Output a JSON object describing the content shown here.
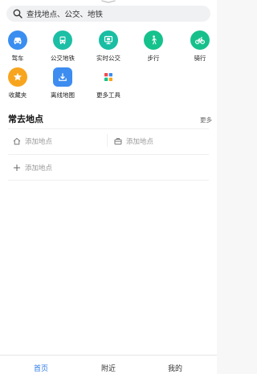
{
  "search": {
    "placeholder": "查找地点、公交、地铁",
    "icon": "search-icon"
  },
  "tools": [
    {
      "label": "驾车",
      "icon": "car-icon",
      "color": "#3a8ef0"
    },
    {
      "label": "公交地铁",
      "icon": "bus-icon",
      "color": "#1bbfa5"
    },
    {
      "label": "实时公交",
      "icon": "realtime-bus-icon",
      "color": "#19bea3"
    },
    {
      "label": "步行",
      "icon": "walk-icon",
      "color": "#16c28c"
    },
    {
      "label": "骑行",
      "icon": "bike-icon",
      "color": "#17c08b"
    },
    {
      "label": "收藏夹",
      "icon": "star-icon",
      "color": "#f7a51e"
    },
    {
      "label": "离线地图",
      "icon": "download-icon",
      "color": "#3d8cf0"
    },
    {
      "label": "更多工具",
      "icon": "grid-icon",
      "color": "#ffffff"
    }
  ],
  "frequent": {
    "title": "常去地点",
    "more": "更多",
    "home": "添加地点",
    "work": "添加地点",
    "add": "添加地点"
  },
  "tabs": [
    {
      "label": "首页",
      "active": true
    },
    {
      "label": "附近",
      "active": false
    },
    {
      "label": "我的",
      "active": false
    }
  ],
  "colors": {
    "accent": "#2f7be6"
  }
}
